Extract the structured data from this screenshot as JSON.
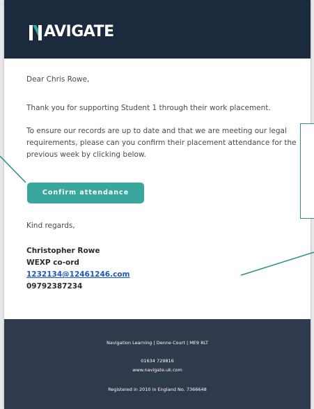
{
  "header": {
    "logo_text": "AVIGATE",
    "brand_color": "#1b2a3d",
    "accent_color": "#3aa79e"
  },
  "email": {
    "greeting": "Dear Chris Rowe,",
    "thanks": "Thank you for supporting Student 1 through their work placement.",
    "request": "To ensure our records are up to date and that we are meeting our legal requirements, please can you confirm their placement attendance for the previous week by clicking below.",
    "confirm_label": "Confirm attendance",
    "regards": "Kind regards,"
  },
  "signature": {
    "name": "Christopher Rowe",
    "role": "WEXP co-ord",
    "email": "1232134@12461246.com",
    "phone": "09792387234"
  },
  "footer": {
    "address": "Navigation Learning | Denne Court | ME9 8LT",
    "phone": "01634 729816",
    "website": "www.navigate.uk.com",
    "registration": "Registered in 2010 in England No. 7366648"
  }
}
